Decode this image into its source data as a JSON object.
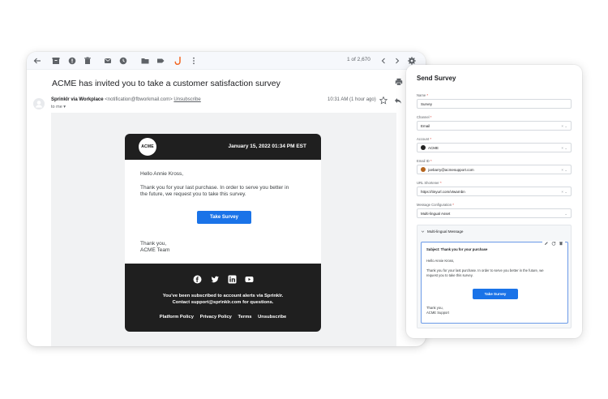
{
  "gmail": {
    "pager": "1 of 2,670",
    "subject": "ACME has invited you to take a customer satisfaction survey",
    "sender_name": "Sprinklr via Workplace",
    "sender_email": "<notification@fbworkmail.com>",
    "unsubscribe": "Unsubscribe",
    "to": "to me",
    "time": "10:31 AM (1 hour ago)",
    "icons": [
      "back-icon",
      "archive-icon",
      "report-icon",
      "delete-icon",
      "mark-unread-icon",
      "snooze-icon",
      "move-icon",
      "label-icon",
      "sprinklr-icon",
      "more-icon",
      "prev-icon",
      "next-icon",
      "settings-icon",
      "print-icon",
      "star-icon",
      "reply-icon"
    ]
  },
  "email": {
    "logo": "ACME",
    "date": "January 15, 2022 01:34 PM EST",
    "greeting": "Hello Annie Kross,",
    "line1": "Thank you for your last purchase. In order to serve you better in",
    "line2": "the future, we request you to take this survey.",
    "button": "Take Survey",
    "signoff1": "Thank you,",
    "signoff2": "ACME Team",
    "footer1": "You've been subscribed to account alerts via Sprinklr.",
    "footer2": "Contact support@sprinklr.com for questions.",
    "links": [
      "Platform Policy",
      "Privacy Policy",
      "Terms",
      "Unsubscribe"
    ]
  },
  "panel": {
    "title": "Send Survey",
    "fields": [
      {
        "label": "Name",
        "value": "Survey"
      },
      {
        "label": "Channel",
        "value": "Email"
      },
      {
        "label": "Account",
        "value": "ACME"
      },
      {
        "label": "Email ID",
        "value": "joebarry@acmesupport.com"
      },
      {
        "label": "URL Shortener",
        "value": "https://tinyurl.com/vtwarnbn"
      },
      {
        "label": "Message Configuration",
        "value": "Multi-lingual Asset"
      }
    ],
    "req": "*",
    "clear": "×",
    "chev": "⌄",
    "multi_heading": "Multi-lingual Message",
    "msg_subject": "Subject: Thank you for your purchase",
    "msg_greeting": "Hello Annie Kross,",
    "msg_line1": "Thank you for your last purchase. In order to serve you better in the future, we",
    "msg_line2": "request you to take this survey.",
    "msg_button": "Take Survey",
    "msg_signoff1": "Thank you,",
    "msg_signoff2": "ACME Support"
  },
  "colors": {
    "accent": "#1a73e8",
    "dark": "#1f1f1f",
    "sprinklr": "#f26522"
  }
}
